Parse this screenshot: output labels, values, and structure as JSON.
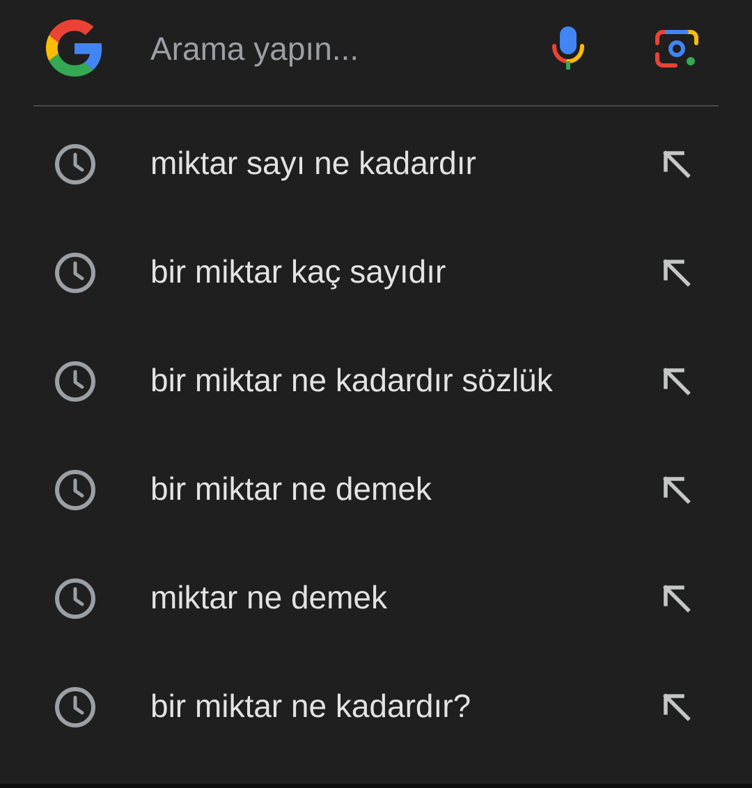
{
  "search": {
    "placeholder": "Arama yapın...",
    "value": ""
  },
  "icons": {
    "logo": "google-g-logo",
    "voice": "mic-icon",
    "lens": "lens-icon",
    "history": "clock-icon",
    "fill": "arrow-up-left-icon"
  },
  "colors": {
    "background": "#1f1f1f",
    "text": "#e3e3e3",
    "placeholder": "#9aa0a6",
    "icon_gray": "#9aa0a6",
    "divider": "#4a4a4a",
    "google_blue": "#4285F4",
    "google_red": "#EA4335",
    "google_yellow": "#FBBC05",
    "google_green": "#34A853"
  },
  "suggestions": [
    {
      "text": "miktar sayı ne kadardır"
    },
    {
      "text": "bir miktar kaç sayıdır"
    },
    {
      "text": "bir miktar ne kadardır sözlük"
    },
    {
      "text": "bir miktar ne demek"
    },
    {
      "text": "miktar ne demek"
    },
    {
      "text": "bir miktar ne kadardır?"
    }
  ]
}
